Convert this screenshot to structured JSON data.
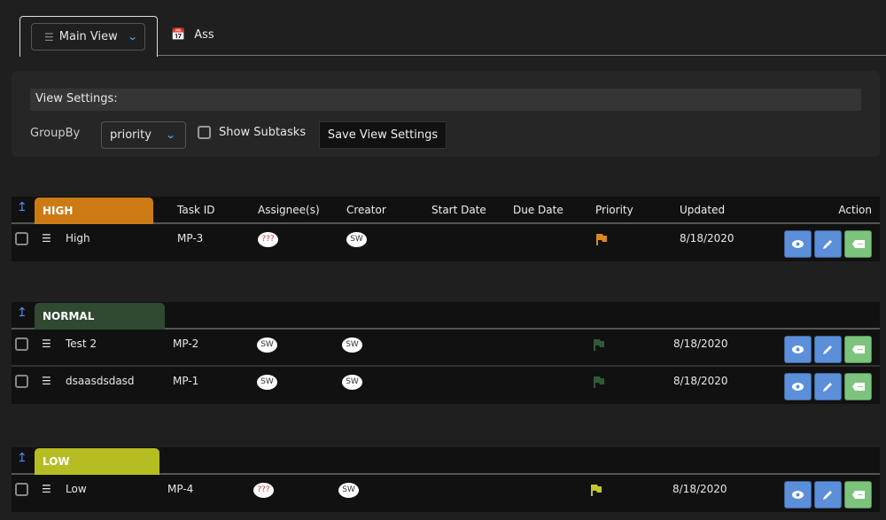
{
  "tabs": {
    "main_view": "Main View",
    "ass": "Ass"
  },
  "settings": {
    "title": "View Settings:",
    "groupby_label": "GroupBy",
    "groupby_value": "priority",
    "show_subtasks": "Show Subtasks",
    "save": "Save View Settings"
  },
  "columns": {
    "task_id": "Task ID",
    "assignees": "Assignee(s)",
    "creator": "Creator",
    "start_date": "Start Date",
    "due_date": "Due Date",
    "priority": "Priority",
    "updated": "Updated",
    "action": "Action"
  },
  "groups": [
    {
      "label": "HIGH",
      "color": "#cc7a14",
      "flag_color": "#d98a1c",
      "rows": [
        {
          "name": "High",
          "id": "MP-3",
          "assignee": "???",
          "creator": "SW",
          "updated": "8/18/2020"
        }
      ]
    },
    {
      "label": "NORMAL",
      "color": "#2f4a30",
      "flag_color": "#2f5a36",
      "rows": [
        {
          "name": "Test 2",
          "id": "MP-2",
          "assignee": "SW",
          "creator": "SW",
          "updated": "8/18/2020"
        },
        {
          "name": "dsaasdsdasd",
          "id": "MP-1",
          "assignee": "SW",
          "creator": "SW",
          "updated": "8/18/2020"
        }
      ]
    },
    {
      "label": "LOW",
      "color": "#b5bd23",
      "flag_color": "#c3c62a",
      "rows": [
        {
          "name": "Low",
          "id": "MP-4",
          "assignee": "???",
          "creator": "SW",
          "updated": "8/18/2020"
        }
      ]
    }
  ]
}
